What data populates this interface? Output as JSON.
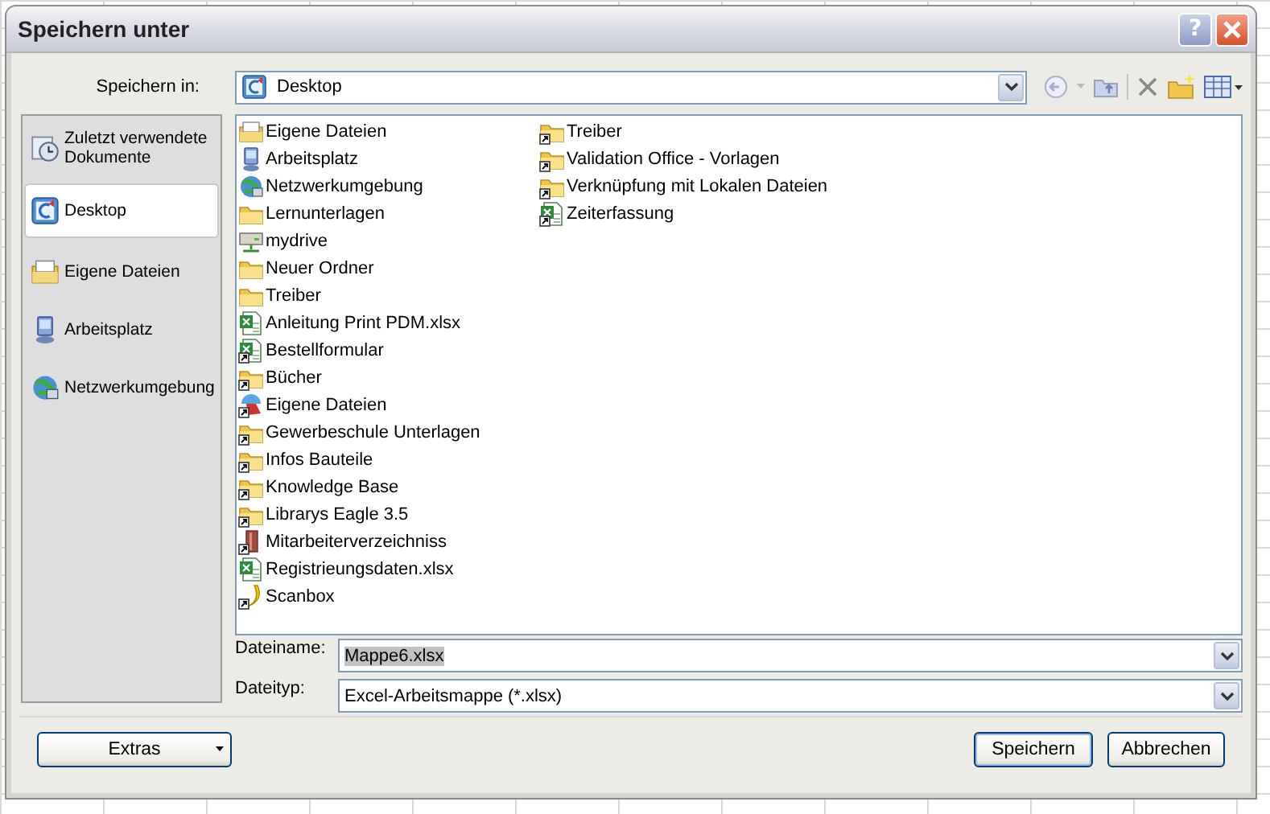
{
  "window": {
    "title": "Speichern unter",
    "help_button": "?"
  },
  "save_in": {
    "label": "Speichern in:",
    "value": "Desktop"
  },
  "places": [
    {
      "label": "Zuletzt verwendete Dokumente",
      "kind": "recent",
      "selected": false
    },
    {
      "label": "Desktop",
      "kind": "desktop",
      "selected": true
    },
    {
      "label": "Eigene Dateien",
      "kind": "documents",
      "selected": false
    },
    {
      "label": "Arbeitsplatz",
      "kind": "computer",
      "selected": false
    },
    {
      "label": "Netzwerkumgebung",
      "kind": "network",
      "selected": false
    }
  ],
  "files": [
    {
      "name": "Eigene Dateien",
      "kind": "documents"
    },
    {
      "name": "Arbeitsplatz",
      "kind": "computer"
    },
    {
      "name": "Netzwerkumgebung",
      "kind": "network"
    },
    {
      "name": "Lernunterlagen",
      "kind": "folder"
    },
    {
      "name": "mydrive",
      "kind": "drive"
    },
    {
      "name": "Neuer Ordner",
      "kind": "folder"
    },
    {
      "name": "Treiber",
      "kind": "folder"
    },
    {
      "name": "Anleitung Print PDM.xlsx",
      "kind": "excel"
    },
    {
      "name": "Bestellformular",
      "kind": "excel-link"
    },
    {
      "name": "Bücher",
      "kind": "folder-link"
    },
    {
      "name": "Eigene Dateien",
      "kind": "app-link"
    },
    {
      "name": "Gewerbeschule Unterlagen",
      "kind": "folder-link"
    },
    {
      "name": "Infos Bauteile",
      "kind": "folder-link"
    },
    {
      "name": "Knowledge Base",
      "kind": "folder-link"
    },
    {
      "name": "Librarys Eagle 3.5",
      "kind": "folder-link"
    },
    {
      "name": "Mitarbeiterverzeichniss",
      "kind": "book-link"
    },
    {
      "name": "Registrieungsdaten.xlsx",
      "kind": "excel"
    },
    {
      "name": "Scanbox",
      "kind": "banana-link"
    },
    {
      "name": "Treiber",
      "kind": "folder-link"
    },
    {
      "name": "Validation Office - Vorlagen",
      "kind": "folder-link"
    },
    {
      "name": "Verknüpfung mit Lokalen Dateien",
      "kind": "folder-link"
    },
    {
      "name": "Zeiterfassung",
      "kind": "excel-link"
    }
  ],
  "filename": {
    "label": "Dateiname:",
    "value": "Mappe6.xlsx",
    "text_selected": true
  },
  "filetype": {
    "label": "Dateityp:",
    "value": "Excel-Arbeitsmappe (*.xlsx)"
  },
  "buttons": {
    "tools": "Extras",
    "save": "Speichern",
    "cancel": "Abbrechen"
  }
}
